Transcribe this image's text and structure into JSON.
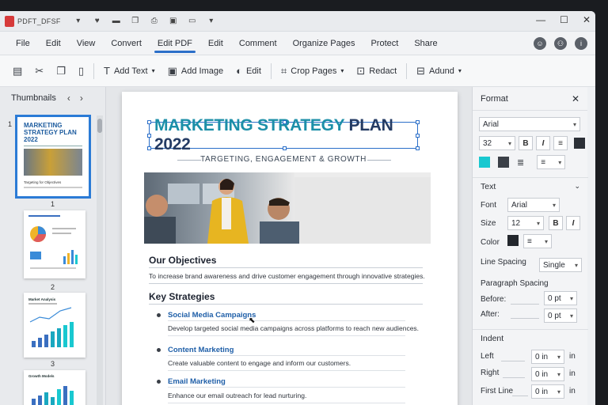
{
  "titlebar": {
    "doc_name": "PDFT_DFSF"
  },
  "menu": {
    "items": [
      "File",
      "Edit",
      "View",
      "Convert",
      "Edit PDF",
      "Edit",
      "Comment",
      "Organize Pages",
      "Protect",
      "Share"
    ],
    "active_index": 4
  },
  "toolbar": {
    "add_text": "Add Text",
    "add_image": "Add Image",
    "edit": "Edit",
    "crop_pages": "Crop Pages",
    "redact": "Redact",
    "adund": "Adund"
  },
  "thumbnails": {
    "title": "Thumbnails",
    "page_numbers": [
      "1",
      "1",
      "2",
      "3"
    ],
    "thumb1_title": "MARKETING STRATEGY PLAN 2022",
    "thumb1_caption": "Targeting for Objectives",
    "thumb3_title": "Market Analysis",
    "thumb4_title": "Growth Models"
  },
  "document": {
    "title_part1": "MARKETING STRATEGY",
    "title_part2": "PLAN 2022",
    "subtitle": "TARGETING, ENGAGEMENT & GROWTH",
    "objectives_heading": "Our Objectives",
    "objectives_text": "To increase brand awareness and drive customer engagement through innovative strategies.",
    "strategies_heading": "Key Strategies",
    "strategies": [
      {
        "name": "Social Media Campaigns",
        "desc": "Develop targeted social media campaigns across platforms to reach new audiences."
      },
      {
        "name": "Content Marketing",
        "desc": "Create valuable content to engage and inform our customers."
      },
      {
        "name": "Email Marketing",
        "desc": "Enhance our email outreach for lead nurturing."
      }
    ]
  },
  "format_panel": {
    "title": "Format",
    "font_value": "Arial",
    "size_value": "32",
    "text_section": "Text",
    "font_label": "Font",
    "font_value2": "Arial",
    "size_label": "Size",
    "size_value2": "12",
    "color_label": "Color",
    "line_spacing_label": "Line Spacing",
    "line_spacing_value": "Single",
    "paragraph_spacing_label": "Paragraph Spacing",
    "before_label": "Before:",
    "before_value": "0 pt",
    "after_label": "After:",
    "after_value": "0 pt",
    "indent_section": "Indent",
    "left_label": "Left",
    "left_value": "0 in",
    "right_label": "Right",
    "right_value": "0 in",
    "first_line_label": "First Line",
    "first_line_value": "0 in",
    "unit": "in"
  },
  "colors": {
    "accent": "#2b6fc9",
    "teal": "#1c8fa8",
    "navy": "#243b63",
    "swatch_cyan": "#19c8d0",
    "swatch_dark": "#3b4048"
  }
}
